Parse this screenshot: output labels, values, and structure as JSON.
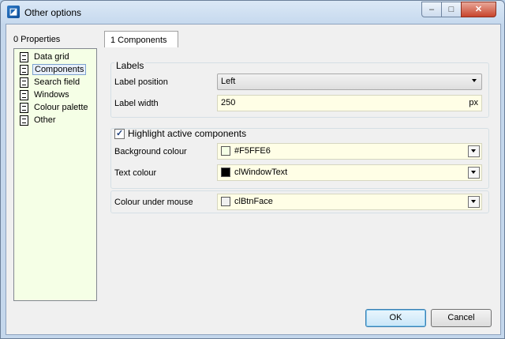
{
  "window": {
    "title": "Other options"
  },
  "titlebar": {
    "min_glyph": "‒",
    "max_glyph": "□",
    "close_glyph": "✕",
    "icon_glyph": "◪"
  },
  "properties": {
    "label": "0 Properties",
    "items": [
      {
        "label": "Data grid"
      },
      {
        "label": "Components"
      },
      {
        "label": "Search field"
      },
      {
        "label": "Windows"
      },
      {
        "label": "Colour palette"
      },
      {
        "label": "Other"
      }
    ],
    "selected_index": 1
  },
  "tab": {
    "label": "1 Components"
  },
  "labels_group": {
    "title": "Labels",
    "position_label": "Label position",
    "position_value": "Left",
    "width_label": "Label width",
    "width_value": "250",
    "width_unit": "px"
  },
  "highlight_group": {
    "checkbox_label": "Highlight active components",
    "checked": true,
    "background_label": "Background colour",
    "background_value": "#F5FFE6",
    "background_swatch": "#F5FFE6",
    "text_label": "Text colour",
    "text_value": "clWindowText",
    "text_swatch": "#000000"
  },
  "mouse_group": {
    "label": "Colour under mouse",
    "value": "clBtnFace",
    "swatch": "#F0F0F0"
  },
  "footer": {
    "ok_label": "OK",
    "cancel_label": "Cancel"
  }
}
